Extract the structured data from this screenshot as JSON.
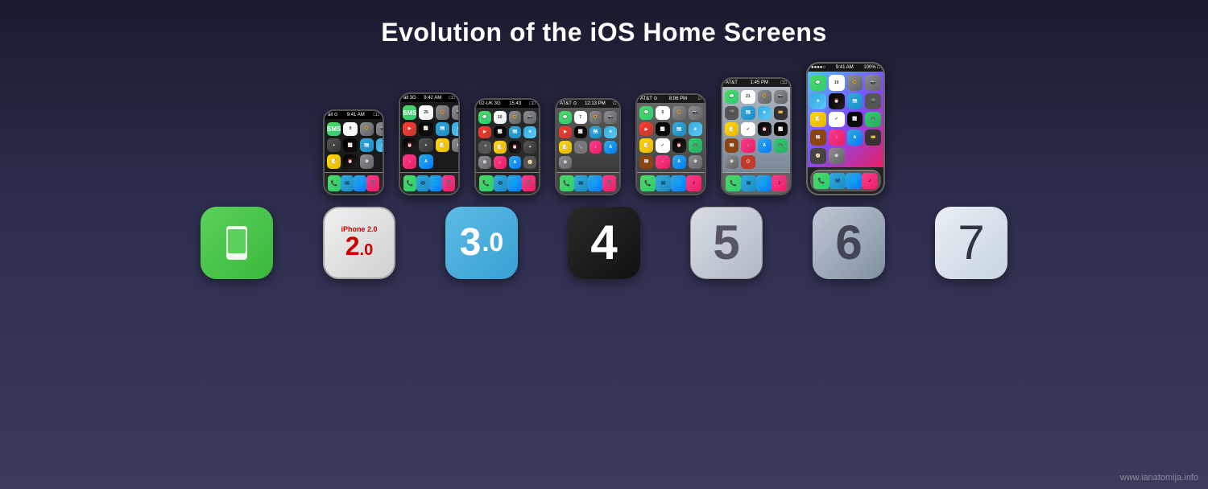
{
  "title": "Evolution of the iOS Home Screens",
  "watermark": "www.ianatomija.info",
  "ios_versions": [
    {
      "id": "ios1",
      "label": "iOS 1",
      "display": "phone-icon",
      "icon_class": "ios-icon-1"
    },
    {
      "id": "ios2",
      "label": "iPhone 2.0",
      "display": "2.0",
      "icon_class": "ios-icon-2"
    },
    {
      "id": "ios3",
      "label": "iOS 3.0",
      "display": "3.0",
      "icon_class": "ios-icon-3"
    },
    {
      "id": "ios4",
      "label": "iOS 4",
      "display": "4",
      "icon_class": "ios-icon-4"
    },
    {
      "id": "ios5",
      "label": "iOS 5",
      "display": "5",
      "icon_class": "ios-icon-5"
    },
    {
      "id": "ios6",
      "label": "iOS 6",
      "display": "6",
      "icon_class": "ios-icon-6"
    },
    {
      "id": "ios7",
      "label": "iOS 7",
      "display": "7",
      "icon_class": "ios-icon-7"
    }
  ],
  "phones": [
    {
      "id": "phone1",
      "version": "iOS 1",
      "status_left": "all  ⊙",
      "status_right": "9:41 AM",
      "size_class": "phone-xs"
    },
    {
      "id": "phone2",
      "version": "iPhone 2.0",
      "status_left": "all  3G",
      "status_right": "9:42 AM",
      "size_class": "phone-xs"
    },
    {
      "id": "phone3",
      "version": "iOS 3",
      "status_left": "02-UK 3G",
      "status_right": "15:43",
      "size_class": "phone-sm"
    },
    {
      "id": "phone4",
      "version": "iOS 4",
      "status_left": "AT&T ⊙",
      "status_right": "12:13 PM",
      "size_class": "phone-sm"
    },
    {
      "id": "phone5",
      "version": "iOS 5",
      "status_left": "AT&T ⊙",
      "status_right": "8:06 PM",
      "size_class": "phone-md"
    },
    {
      "id": "phone6",
      "version": "iOS 6",
      "status_left": "AT&T",
      "status_right": "1:45 PM",
      "size_class": "phone-md"
    },
    {
      "id": "phone7",
      "version": "iOS 7",
      "status_left": "●●●●○",
      "status_right": "9:41 AM",
      "size_class": "phone-lg"
    }
  ]
}
